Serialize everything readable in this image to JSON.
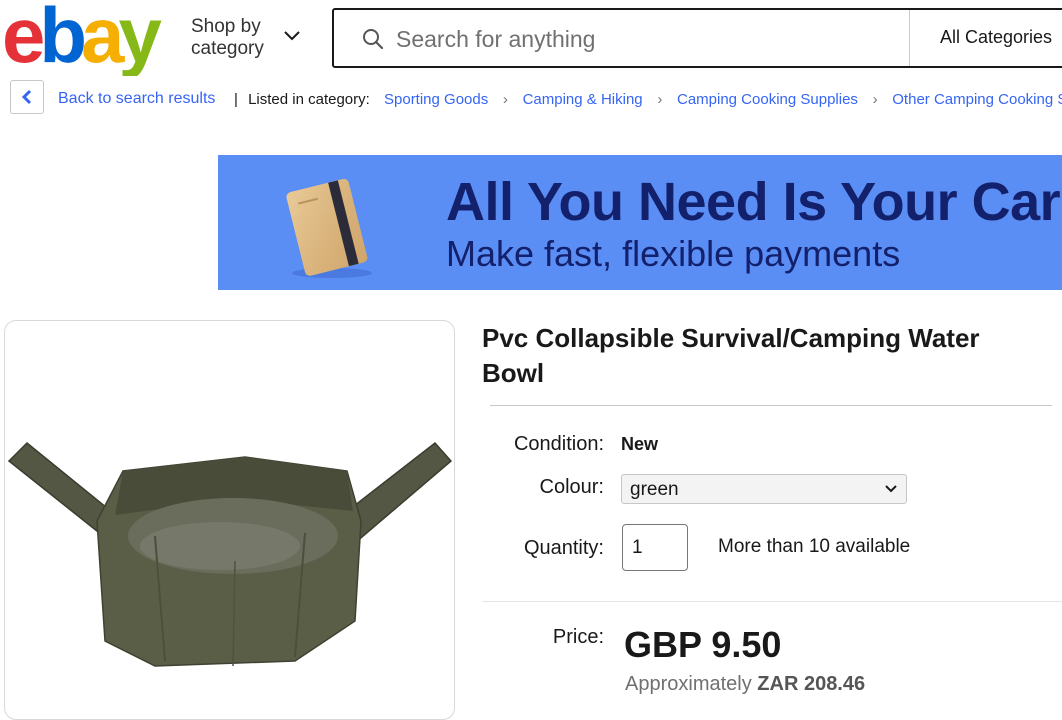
{
  "header": {
    "logo_text": "ebay",
    "shop_by_line1": "Shop by",
    "shop_by_line2": "category",
    "search_placeholder": "Search for anything",
    "category_select": "All Categories"
  },
  "breadcrumb": {
    "back_label": "Back to search results",
    "separator": "|",
    "listed_label": "Listed in category:",
    "items": [
      {
        "label": "Sporting Goods"
      },
      {
        "label": "Camping & Hiking"
      },
      {
        "label": "Camping Cooking Supplies"
      },
      {
        "label": "Other Camping Cooking Supplies"
      }
    ]
  },
  "banner": {
    "headline": "All You Need Is Your Card",
    "subline": "Make fast, flexible payments"
  },
  "product": {
    "title": "Pvc Collapsible Survival/Camping Water Bowl",
    "condition_label": "Condition:",
    "condition_value": "New",
    "colour_label": "Colour:",
    "colour_value": "green",
    "quantity_label": "Quantity:",
    "quantity_value": "1",
    "availability": "More than 10 available",
    "price_label": "Price:",
    "price": "GBP 9.50",
    "approx_prefix": "Approximately",
    "approx_value": "ZAR 208.46"
  },
  "colors": {
    "logo_e": "#e53238",
    "logo_b": "#0064d2",
    "logo_a": "#f5af02",
    "logo_y": "#86b817",
    "link": "#3665f3",
    "banner_bg": "#5b8ef5",
    "banner_text": "#13206b"
  }
}
